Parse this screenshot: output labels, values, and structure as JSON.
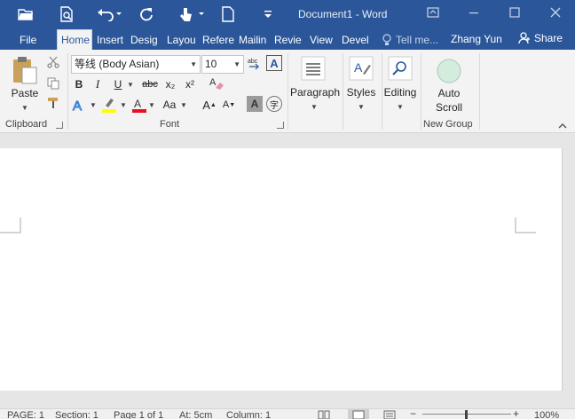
{
  "window": {
    "doc_title": "Document1 - Word",
    "user": "Zhang Yun",
    "share_label": "Share",
    "tell_me_placeholder": "Tell me..."
  },
  "tabs": [
    {
      "label": "File",
      "active": false
    },
    {
      "label": "Home",
      "active": true
    },
    {
      "label": "Insert",
      "active": false
    },
    {
      "label": "Desig",
      "active": false
    },
    {
      "label": "Layou",
      "active": false
    },
    {
      "label": "Refere",
      "active": false
    },
    {
      "label": "Mailin",
      "active": false
    },
    {
      "label": "Revie",
      "active": false
    },
    {
      "label": "View",
      "active": false
    },
    {
      "label": "Devel",
      "active": false
    }
  ],
  "ribbon": {
    "clipboard": {
      "group_label": "Clipboard",
      "paste_label": "Paste"
    },
    "font": {
      "group_label": "Font",
      "font_name": "等线 (Body Asian)",
      "font_size": "10",
      "bold": "B",
      "italic": "I",
      "underline": "U",
      "strikethrough": "abc",
      "subscript": "x₂",
      "superscript": "x²",
      "grow_font": "A",
      "shrink_font": "A",
      "change_case": "Aa",
      "shading": "A",
      "char_border": "A",
      "phonetic": "字"
    },
    "paragraph": {
      "label": "Paragraph"
    },
    "styles": {
      "label": "Styles"
    },
    "editing": {
      "label": "Editing"
    },
    "new_group": {
      "group_label": "New Group",
      "auto_scroll_line1": "Auto",
      "auto_scroll_line2": "Scroll"
    }
  },
  "colors": {
    "title_blue": "#2b579a",
    "highlight_yellow": "#ffff00",
    "font_red": "#e81123"
  },
  "status": {
    "page": "PAGE: 1",
    "section": "Section: 1",
    "page_of": "Page 1 of 1",
    "at": "At: 5cm",
    "column": "Column: 1",
    "zoom": "100%"
  }
}
